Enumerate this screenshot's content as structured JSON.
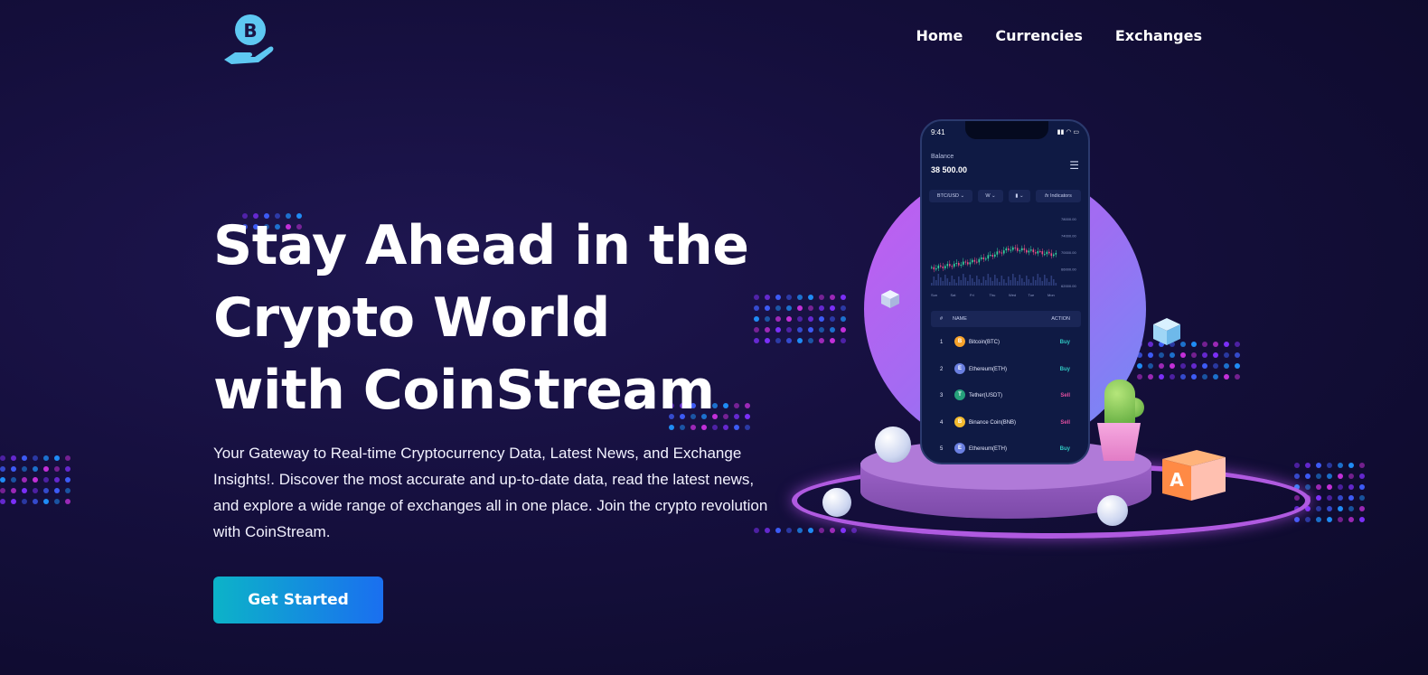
{
  "brand": {
    "logo_icon": "bitcoin-hand-icon",
    "logo_letter": "B"
  },
  "nav": {
    "items": [
      "Home",
      "Currencies",
      "Exchanges"
    ]
  },
  "hero": {
    "title_lines": [
      "Stay Ahead in the",
      "Crypto World",
      "with CoinStream"
    ],
    "description": "Your Gateway to Real-time Cryptocurrency Data, Latest News, and Exchange Insights!. Discover the most accurate and up-to-date data, read the latest news, and explore a wide range of exchanges all in one place. Join the crypto revolution with CoinStream.",
    "cta_label": "Get Started"
  },
  "phone": {
    "time": "9:41",
    "balance_label": "Balance",
    "balance_value": "38 500.00",
    "controls": [
      "BTC/USD",
      "W",
      "Indicators"
    ],
    "y_ticks": [
      "78000.00",
      "74000.00",
      "70000.00",
      "66000.00",
      "62000.00"
    ],
    "x_ticks": [
      "Sun",
      "Sat",
      "Fri",
      "Thu",
      "Wed",
      "Tue",
      "Mon"
    ],
    "table": {
      "headers": [
        "#",
        "NAME",
        "ACTION"
      ],
      "rows": [
        {
          "num": "1",
          "name": "Bitcoin(BTC)",
          "action": "Buy",
          "coin_color": "#f7a32b",
          "coin": "B"
        },
        {
          "num": "2",
          "name": "Ethereum(ETH)",
          "action": "Buy",
          "coin_color": "#6a7fe0",
          "coin": "E"
        },
        {
          "num": "3",
          "name": "Tether(USDT)",
          "action": "Sell",
          "coin_color": "#26a17b",
          "coin": "T"
        },
        {
          "num": "4",
          "name": "Binance Coin(BNB)",
          "action": "Sell",
          "coin_color": "#f3ba2f",
          "coin": "B"
        },
        {
          "num": "5",
          "name": "Ethereum(ETH)",
          "action": "Buy",
          "coin_color": "#6a7fe0",
          "coin": "E"
        }
      ]
    }
  },
  "illustration": {
    "box_letter": "A"
  },
  "colors": {
    "accent_start": "#0cb3c8",
    "accent_end": "#1a6ff0",
    "buy": "#2fc7c2",
    "sell": "#e34fa0"
  }
}
